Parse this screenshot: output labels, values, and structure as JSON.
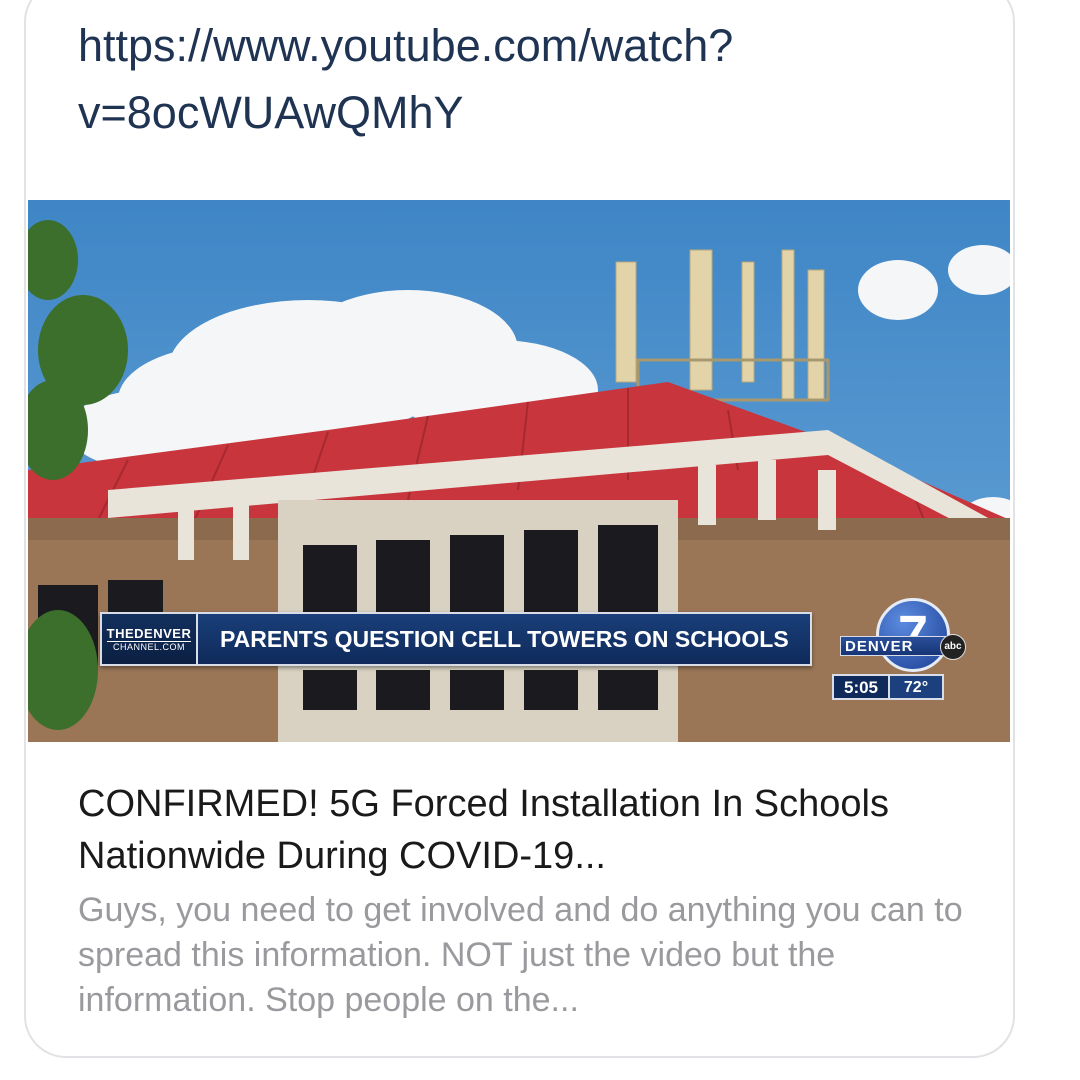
{
  "link_preview": {
    "url_line1": "https://www.youtube.com/watch?",
    "url_line2": "v=8ocWUAwQMhY",
    "thumbnail": {
      "logo_line1": "THEDENVER",
      "logo_line2": "CHANNEL.COM",
      "chyron_headline": "PARENTS QUESTION CELL TOWERS ON SCHOOLS",
      "station_number": "7",
      "station_name": "DENVER",
      "network": "abc",
      "time": "5:05",
      "temperature": "72°"
    },
    "title": "CONFIRMED! 5G Forced Installation In Schools Nationwide During COVID-19...",
    "description": "Guys, you need to get involved and do anything you can to spread this information. NOT just the video but the information. Stop people on the...",
    "colors": {
      "url": "#1f3352",
      "title": "#1a1a1a",
      "description": "#9a9a9e",
      "chyron": "#0f2a5a",
      "roof": "#c8353c",
      "sky": "#4d8fc9"
    }
  }
}
